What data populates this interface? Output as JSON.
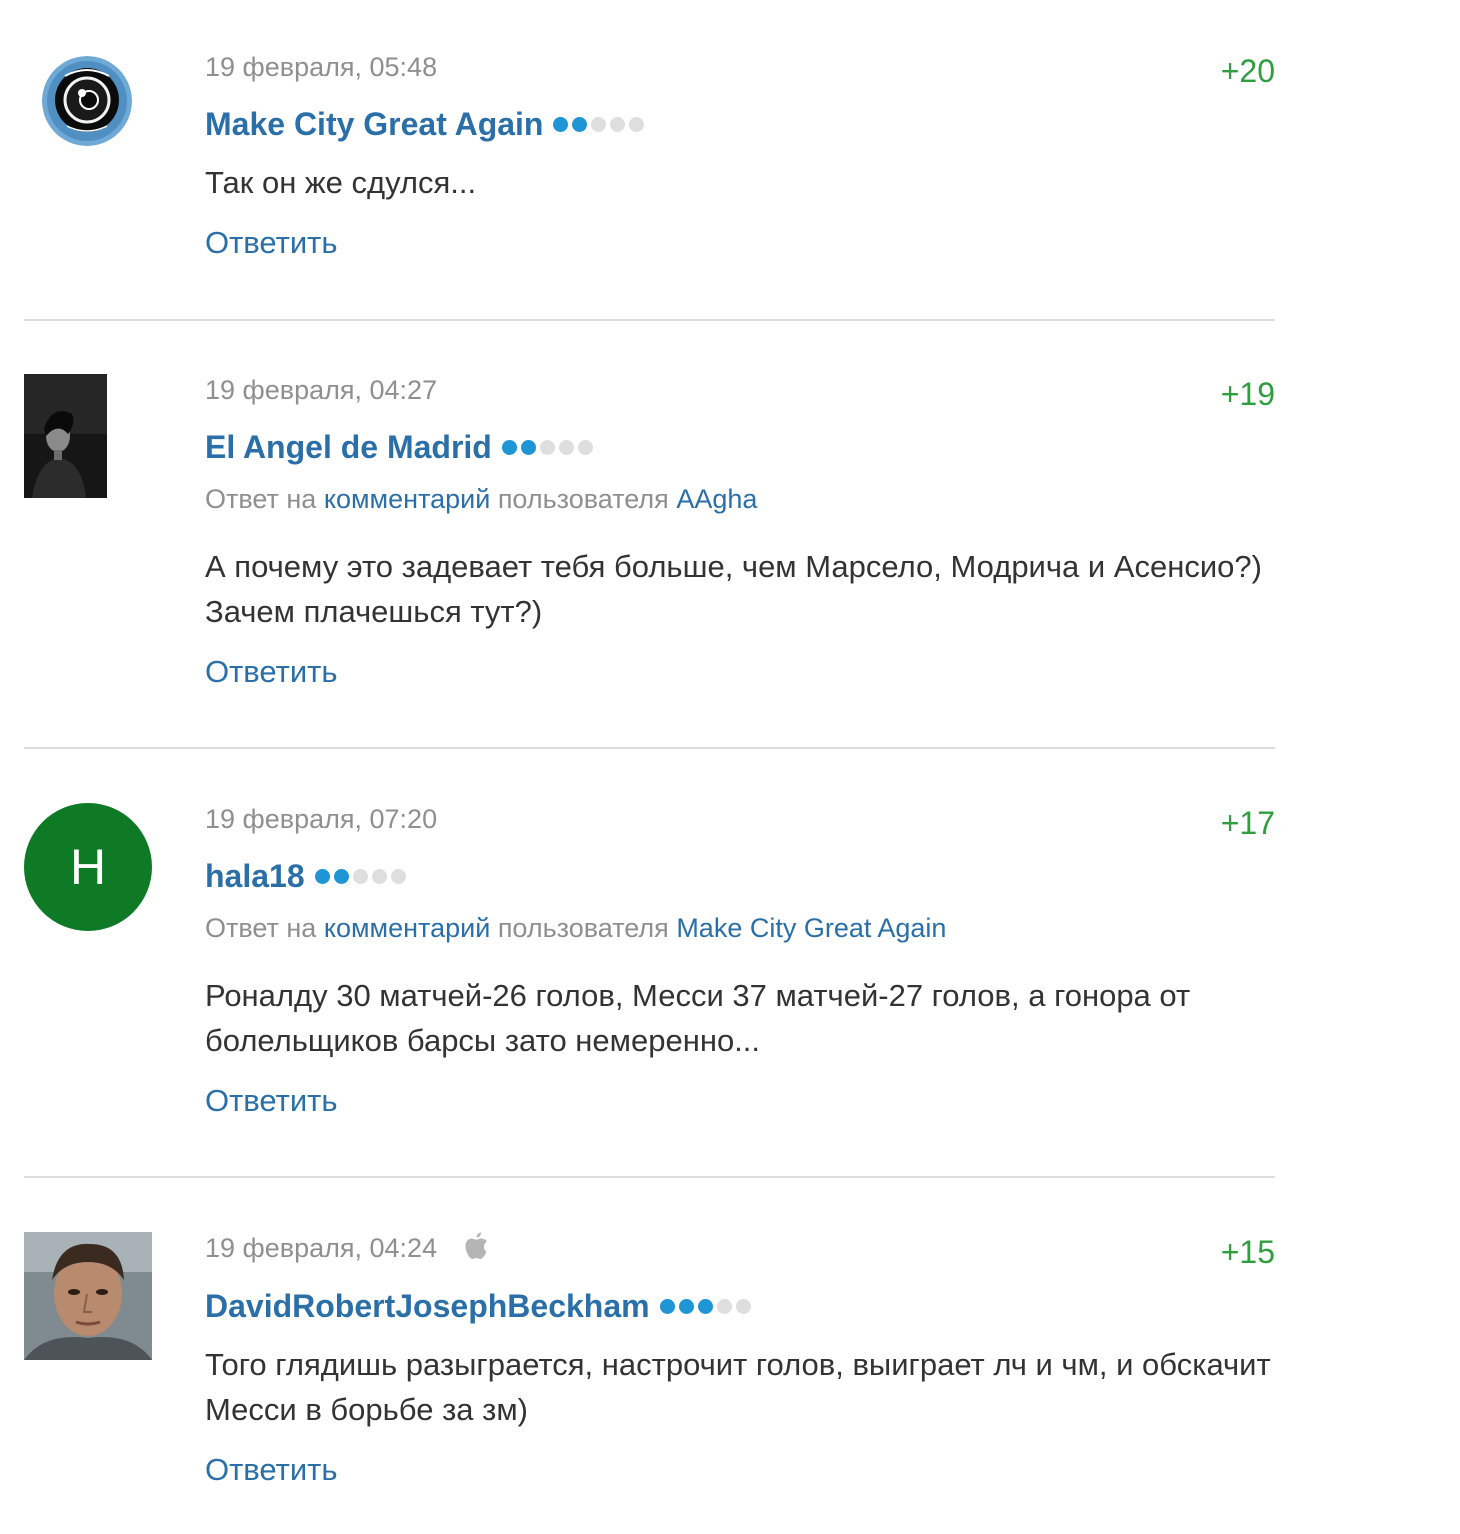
{
  "comments": [
    {
      "date": "19 февраля, 05:48",
      "rating": "+20",
      "author": "Make City Great Again",
      "level": 2,
      "avatar": "camera-lens-avatar",
      "text": "Так он же сдулся...",
      "reply_label": "Ответить"
    },
    {
      "date": "19 февраля, 04:27",
      "rating": "+19",
      "author": "El Angel de Madrid",
      "level": 2,
      "avatar": "dark-portrait-avatar",
      "reply_prefix": "Ответ на",
      "reply_link": "комментарий",
      "reply_mid": "пользователя",
      "reply_user": "AAgha",
      "text": "А почему это задевает тебя больше, чем Марсело, Модрича и Асенсио?) Зачем плачешься тут?)",
      "reply_label": "Ответить"
    },
    {
      "date": "19 февраля, 07:20",
      "rating": "+17",
      "author": "hala18",
      "level": 2,
      "avatar_letter": "H",
      "avatar_color": "#0f7a26",
      "reply_prefix": "Ответ на",
      "reply_link": "комментарий",
      "reply_mid": "пользователя",
      "reply_user": "Make City Great Again",
      "text": "Роналду 30 матчей-26 голов, Месси 37 матчей-27 голов, а гонора от болельщиков барсы зато немеренно...",
      "reply_label": "Ответить"
    },
    {
      "date": "19 февраля, 04:24",
      "rating": "+15",
      "author": "DavidRobertJosephBeckham",
      "level": 3,
      "avatar": "face-photo-avatar",
      "device_icon": "apple-icon",
      "text": "Того глядишь разыграется, настрочит голов, выиграет лч и чм, и обскачит Месси в борьбе за зм)",
      "reply_label": "Ответить"
    }
  ],
  "colors": {
    "author": "#2a6fa8",
    "rating": "#2e9e3e",
    "meta": "#8f8f8f",
    "level_on": "#1e95d4",
    "level_off": "#dedede",
    "divider": "#dcdcdc"
  }
}
